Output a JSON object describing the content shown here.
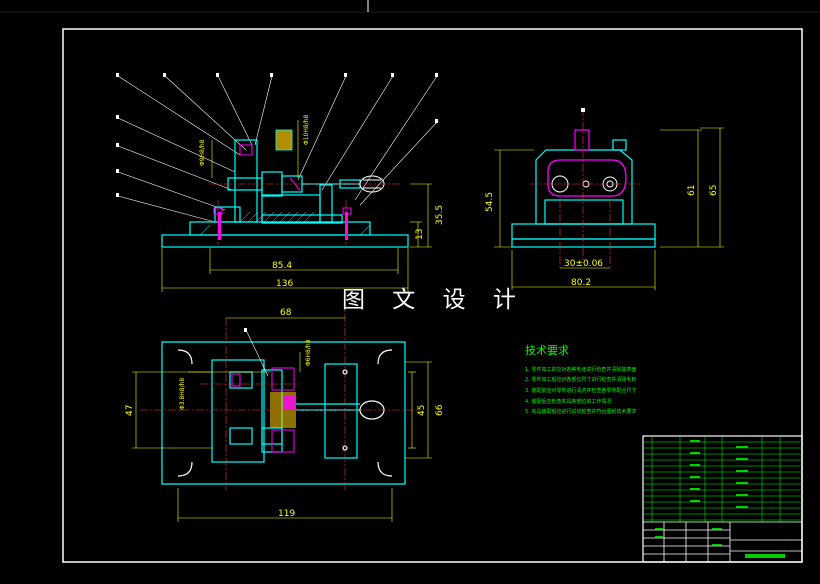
{
  "drawing": {
    "overlay_title": "图 文 设 计",
    "front_view": {
      "dim_horizontal_1": "85.4",
      "dim_horizontal_2": "136",
      "dim_vertical_1": "35.5",
      "dim_vertical_2": "13",
      "dim_dia_1": "Φ10H8/h8",
      "dim_dia_2": "Φ9H8/h8"
    },
    "side_view": {
      "dim_height_1": "54.5",
      "dim_height_2": "61",
      "dim_height_3": "65",
      "dim_width_1": "30±0.06",
      "dim_width_2": "80.2"
    },
    "top_view": {
      "dim_top": "68",
      "dim_left": "47",
      "dim_right_1": "45",
      "dim_right_2": "66",
      "dim_bottom": "119",
      "dim_dia_1": "Φ3.8H8/h8",
      "dim_dia_2": "Φ6H8/h8"
    },
    "tech_requirements": {
      "title": "技术要求",
      "lines": [
        "1. 零件加工前应对各种毛坯进行检查并清除其表面",
        "2. 零件加工后应对各部位尺寸进行检查并清除毛刺",
        "3. 装配前应对零件进行清洗并检查各零件配合尺寸",
        "4. 装配后应检查夹具各部位的工作情况",
        "5. 夹具装配后应进行试切检查并符合图纸技术要求"
      ]
    },
    "colors": {
      "background": "#000000",
      "frame": "#ffffff",
      "part": "#00ffff",
      "dimension": "#ffff00",
      "centerline": "#ff3333",
      "accent": "#ff00ff",
      "text": "#00ff00"
    }
  }
}
